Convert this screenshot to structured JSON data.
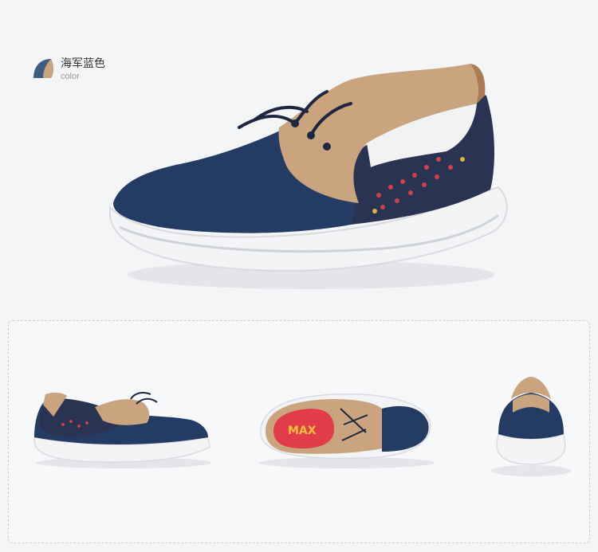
{
  "color_label": {
    "name": "海军蓝色",
    "subtitle": "color",
    "swatch_color": "#3d5c80",
    "swatch_accent": "#c9a47e"
  },
  "product": {
    "main_color": "#243b63",
    "suede_color": "#c9a47e",
    "sole_color": "#f3f4f6",
    "mesh_accent": "#e0454a",
    "insole_color": "#e23b4a",
    "insole_logo": "MAX"
  }
}
